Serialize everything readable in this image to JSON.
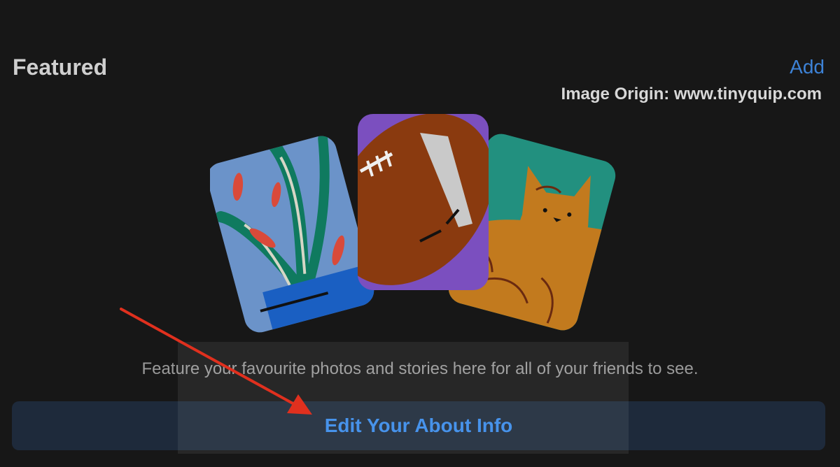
{
  "header": {
    "title": "Featured",
    "add_label": "Add"
  },
  "watermark": "Image Origin: www.tinyquip.com",
  "empty_state": {
    "illustration": [
      "plant-card",
      "football-card",
      "cat-card"
    ],
    "caption": "Feature your favourite photos and stories here for all of your friends to see."
  },
  "cta": {
    "label": "Edit Your About Info"
  },
  "colors": {
    "background": "#171717",
    "accent": "#3a8bea",
    "button_bg": "#1e2a3b",
    "annotation_arrow": "#e0301e"
  }
}
